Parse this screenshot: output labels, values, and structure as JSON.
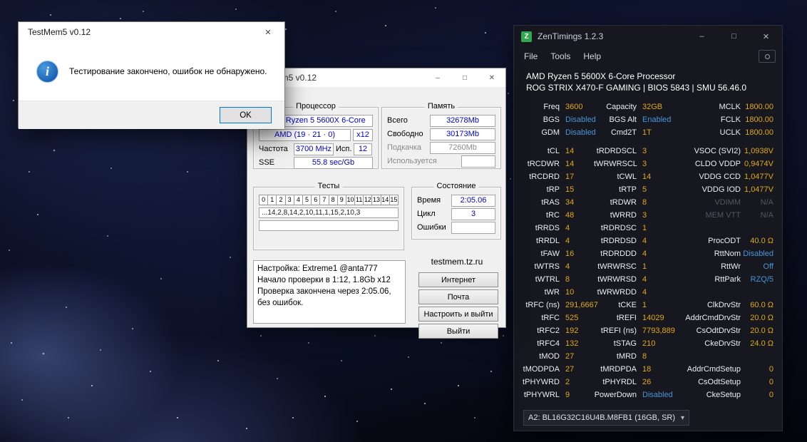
{
  "colors": {
    "zt_value_gold": "#dfa913",
    "zt_info_blue": "#4596d8",
    "zt_na_gray": "#565660",
    "tm_value_blue": "#0000cd",
    "logo_green": "#2fa84f",
    "dialog_accent": "#0078d7"
  },
  "icons": {
    "logo": "Z",
    "minimize": "–",
    "maximize": "□",
    "close": "✕",
    "dropdown": "▾",
    "info": "i"
  },
  "dialog": {
    "title": "TestMem5 v0.12",
    "message": "Тестирование закончено, ошибок не обнаружено.",
    "ok": "OK"
  },
  "testmem": {
    "title": "TestMem5 v0.12",
    "processor": {
      "label": "Процессор",
      "cpu": "AMD Ryzen 5 5600X 6-Core",
      "cpuid": "AMD (19 · 21 · 0)",
      "mult": "x12",
      "freq_label": "Частота",
      "freq": "3700 MHz",
      "used_label": "Исп.",
      "used": "12",
      "sse_label": "SSE",
      "sse": "55.8 sec/Gb"
    },
    "memory": {
      "label": "Память",
      "rows": [
        {
          "label": "Всего",
          "value": "32678Mb"
        },
        {
          "label": "Свободно",
          "value": "30173Mb"
        },
        {
          "label": "Подкачка",
          "value": "7260Mb"
        },
        {
          "label": "Используется",
          "value": ""
        }
      ]
    },
    "tests": {
      "label": "Тесты",
      "cells": [
        "0",
        "1",
        "2",
        "3",
        "4",
        "5",
        "6",
        "7",
        "8",
        "9",
        "10",
        "11",
        "12",
        "13",
        "14",
        "15"
      ],
      "seq1": "...14,2,8,14,2,10,11,1,15,2,10,3",
      "seq2": ""
    },
    "state": {
      "label": "Состояние",
      "rows": [
        {
          "label": "Время",
          "value": "2:05.06"
        },
        {
          "label": "Цикл",
          "value": "3"
        },
        {
          "label": "Ошибки",
          "value": ""
        }
      ]
    },
    "log_lines": [
      "Настройка: Extreme1 @anta777",
      "Начало проверки в 1:12, 1.8Gb x12",
      "Проверка закончена через 2:05.06,",
      "без ошибок."
    ],
    "site": "testmem.tz.ru",
    "buttons": [
      "Интернет",
      "Почта",
      "Настроить и выйти",
      "Выйти"
    ]
  },
  "zentimings": {
    "title": "ZenTimings 1.2.3",
    "menu": [
      "File",
      "Tools",
      "Help"
    ],
    "cpu": "AMD Ryzen 5 5600X 6-Core Processor",
    "board": "ROG STRIX X470-F GAMING | BIOS 5843 | SMU 56.46.0",
    "dimm": "A2: BL16G32C16U4B.M8FB1 (16GB, SR)",
    "rows": [
      {
        "c": [
          {
            "l": "Freq",
            "v": "3600"
          },
          {
            "l": "Capacity",
            "v": "32GB"
          },
          {
            "l": "MCLK",
            "v": "1800.00"
          }
        ]
      },
      {
        "c": [
          {
            "l": "BGS",
            "v": "Disabled",
            "vc": "info"
          },
          {
            "l": "BGS Alt",
            "v": "Enabled",
            "vc": "info"
          },
          {
            "l": "FCLK",
            "v": "1800.00"
          }
        ]
      },
      {
        "c": [
          {
            "l": "GDM",
            "v": "Disabled",
            "vc": "info"
          },
          {
            "l": "Cmd2T",
            "v": "1T"
          },
          {
            "l": "UCLK",
            "v": "1800.00"
          }
        ],
        "gap": true
      },
      {
        "c": [
          {
            "l": "tCL",
            "v": "14"
          },
          {
            "l": "tRDRDSCL",
            "v": "3"
          },
          {
            "l": "VSOC (SVI2)",
            "v": "1,0938V"
          }
        ]
      },
      {
        "c": [
          {
            "l": "tRCDWR",
            "v": "14"
          },
          {
            "l": "tWRWRSCL",
            "v": "3"
          },
          {
            "l": "CLDO VDDP",
            "v": "0,9474V"
          }
        ]
      },
      {
        "c": [
          {
            "l": "tRCDRD",
            "v": "17"
          },
          {
            "l": "tCWL",
            "v": "14"
          },
          {
            "l": "VDDG CCD",
            "v": "1,0477V"
          }
        ]
      },
      {
        "c": [
          {
            "l": "tRP",
            "v": "15"
          },
          {
            "l": "tRTP",
            "v": "5"
          },
          {
            "l": "VDDG IOD",
            "v": "1,0477V"
          }
        ]
      },
      {
        "c": [
          {
            "l": "tRAS",
            "v": "34"
          },
          {
            "l": "tRDWR",
            "v": "8"
          },
          {
            "l": "VDIMM",
            "v": "N/A",
            "lc": "na",
            "vc": "na"
          }
        ]
      },
      {
        "c": [
          {
            "l": "tRC",
            "v": "48"
          },
          {
            "l": "tWRRD",
            "v": "3"
          },
          {
            "l": "MEM VTT",
            "v": "N/A",
            "lc": "na",
            "vc": "na"
          }
        ]
      },
      {
        "c": [
          {
            "l": "tRRDS",
            "v": "4"
          },
          {
            "l": "tRDRDSC",
            "v": "1"
          },
          {
            "l": "",
            "v": ""
          }
        ]
      },
      {
        "c": [
          {
            "l": "tRRDL",
            "v": "4"
          },
          {
            "l": "tRDRDSD",
            "v": "4"
          },
          {
            "l": "ProcODT",
            "v": "40.0 Ω"
          }
        ]
      },
      {
        "c": [
          {
            "l": "tFAW",
            "v": "16"
          },
          {
            "l": "tRDRDDD",
            "v": "4"
          },
          {
            "l": "RttNom",
            "v": "Disabled",
            "vc": "info"
          }
        ]
      },
      {
        "c": [
          {
            "l": "tWTRS",
            "v": "4"
          },
          {
            "l": "tWRWRSC",
            "v": "1"
          },
          {
            "l": "RttWr",
            "v": "Off",
            "vc": "info"
          }
        ]
      },
      {
        "c": [
          {
            "l": "tWTRL",
            "v": "8"
          },
          {
            "l": "tWRWRSD",
            "v": "4"
          },
          {
            "l": "RttPark",
            "v": "RZQ/5",
            "vc": "info"
          }
        ]
      },
      {
        "c": [
          {
            "l": "tWR",
            "v": "10"
          },
          {
            "l": "tWRWRDD",
            "v": "4"
          },
          {
            "l": "",
            "v": ""
          }
        ]
      },
      {
        "c": [
          {
            "l": "tRFC (ns)",
            "v": "291,6667"
          },
          {
            "l": "tCKE",
            "v": "1"
          },
          {
            "l": "ClkDrvStr",
            "v": "60.0 Ω"
          }
        ]
      },
      {
        "c": [
          {
            "l": "tRFC",
            "v": "525"
          },
          {
            "l": "tREFI",
            "v": "14029"
          },
          {
            "l": "AddrCmdDrvStr",
            "v": "20.0 Ω"
          }
        ]
      },
      {
        "c": [
          {
            "l": "tRFC2",
            "v": "192"
          },
          {
            "l": "tREFI (ns)",
            "v": "7793,889"
          },
          {
            "l": "CsOdtDrvStr",
            "v": "20.0 Ω"
          }
        ]
      },
      {
        "c": [
          {
            "l": "tRFC4",
            "v": "132"
          },
          {
            "l": "tSTAG",
            "v": "210"
          },
          {
            "l": "CkeDrvStr",
            "v": "24.0 Ω"
          }
        ]
      },
      {
        "c": [
          {
            "l": "tMOD",
            "v": "27"
          },
          {
            "l": "tMRD",
            "v": "8"
          },
          {
            "l": "",
            "v": ""
          }
        ]
      },
      {
        "c": [
          {
            "l": "tMODPDA",
            "v": "27"
          },
          {
            "l": "tMRDPDA",
            "v": "18"
          },
          {
            "l": "AddrCmdSetup",
            "v": "0"
          }
        ]
      },
      {
        "c": [
          {
            "l": "tPHYWRD",
            "v": "2"
          },
          {
            "l": "tPHYRDL",
            "v": "26"
          },
          {
            "l": "CsOdtSetup",
            "v": "0"
          }
        ]
      },
      {
        "c": [
          {
            "l": "tPHYWRL",
            "v": "9"
          },
          {
            "l": "PowerDown",
            "v": "Disabled",
            "vc": "info"
          },
          {
            "l": "CkeSetup",
            "v": "0"
          }
        ]
      }
    ]
  }
}
